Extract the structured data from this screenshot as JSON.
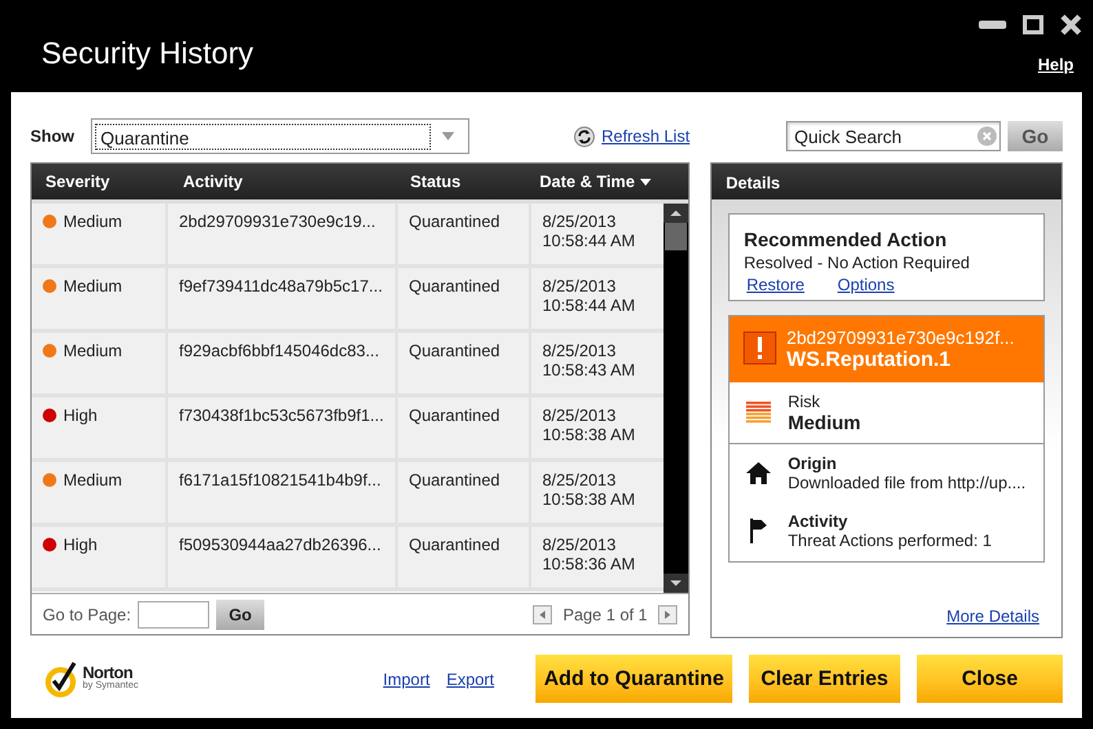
{
  "window": {
    "title": "Security History",
    "help": "Help"
  },
  "toolbar": {
    "show_label": "Show",
    "show_value": "Quarantine",
    "refresh": "Refresh List",
    "search": {
      "placeholder": "Quick Search"
    },
    "search_button": "Go"
  },
  "table": {
    "columns": [
      "Severity",
      "Activity",
      "Status",
      "Date & Time"
    ],
    "rows": [
      {
        "severity": "Medium",
        "color": "#f07818",
        "activity": "2bd29709931e730e9c19...",
        "status": "Quarantined",
        "date": "8/25/2013",
        "time": "10:58:44 AM"
      },
      {
        "severity": "Medium",
        "color": "#f07818",
        "activity": "f9ef739411dc48a79b5c17...",
        "status": "Quarantined",
        "date": "8/25/2013",
        "time": "10:58:44 AM"
      },
      {
        "severity": "Medium",
        "color": "#f07818",
        "activity": "f929acbf6bbf145046dc83...",
        "status": "Quarantined",
        "date": "8/25/2013",
        "time": "10:58:43 AM"
      },
      {
        "severity": "High",
        "color": "#d00000",
        "activity": "f730438f1bc53c5673fb9f1...",
        "status": "Quarantined",
        "date": "8/25/2013",
        "time": "10:58:38 AM"
      },
      {
        "severity": "Medium",
        "color": "#f07818",
        "activity": "f6171a15f10821541b4b9f...",
        "status": "Quarantined",
        "date": "8/25/2013",
        "time": "10:58:38 AM"
      },
      {
        "severity": "High",
        "color": "#d00000",
        "activity": "f509530944aa27db26396...",
        "status": "Quarantined",
        "date": "8/25/2013",
        "time": "10:58:36 AM"
      }
    ],
    "footer": {
      "goto_label": "Go to Page:",
      "go": "Go",
      "page": "Page 1 of 1"
    }
  },
  "details": {
    "title": "Details",
    "recommended": {
      "title": "Recommended Action",
      "text": "Resolved - No Action Required",
      "links": [
        "Restore",
        "Options"
      ]
    },
    "threat": {
      "file": "2bd29709931e730e9c192f...",
      "name": "WS.Reputation.1"
    },
    "risk": {
      "label": "Risk",
      "value": "Medium"
    },
    "origin": {
      "label": "Origin",
      "value": "Downloaded file from http://up...."
    },
    "activity": {
      "label": "Activity",
      "value": "Threat Actions performed: 1"
    },
    "more": "More Details"
  },
  "footer": {
    "logo": {
      "name": "Norton",
      "sub": "by Symantec"
    },
    "links": [
      "Import",
      "Export"
    ],
    "buttons": [
      "Add to Quarantine",
      "Clear Entries",
      "Close"
    ]
  }
}
